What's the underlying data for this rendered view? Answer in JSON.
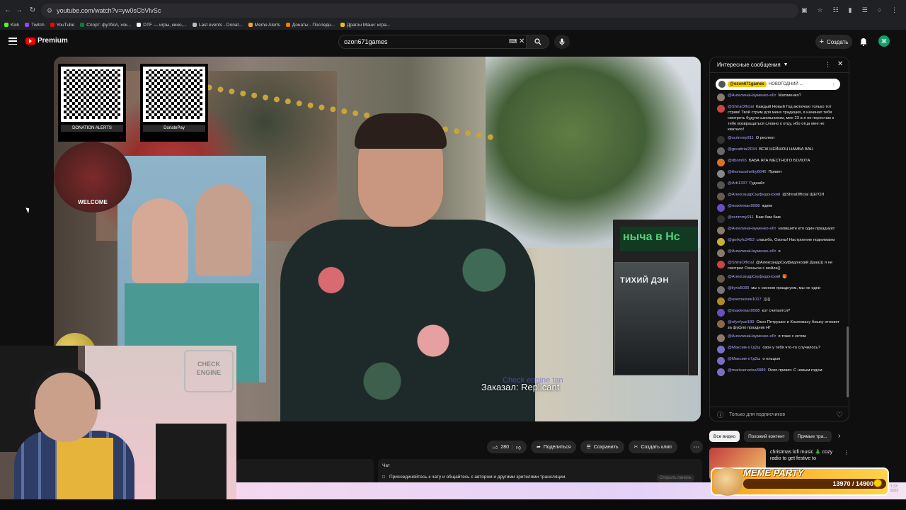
{
  "browser": {
    "url": "youtube.com/watch?v=yw0sCbVlvSc",
    "bookmarks": [
      {
        "label": "Kick",
        "color": "#53fc18"
      },
      {
        "label": "Twitch",
        "color": "#9146ff"
      },
      {
        "label": "YouTube",
        "color": "#ff0000"
      },
      {
        "label": "Спорт: футбол, хок...",
        "color": "#0a7d3a"
      },
      {
        "label": "DTF — игры, кино,...",
        "color": "#ffffff"
      },
      {
        "label": "Last events - Donat...",
        "color": "#bbbbbb"
      },
      {
        "label": "Meme Alerts",
        "color": "#f5a623"
      },
      {
        "label": "Донаты - Последн...",
        "color": "#f57c00"
      },
      {
        "label": "Драгон Мани: игра...",
        "color": "#f0c000"
      }
    ]
  },
  "yt": {
    "brand": "Premium",
    "search_value": "ozon671games",
    "create_label": "Создать",
    "avatar_letter": "Ж"
  },
  "video": {
    "caption": "Заказал: Replicant",
    "caption_ghost": "Check engine tan",
    "qr1_label": "DONATION ALERTS",
    "qr2_label": "DonatePay",
    "welcome": "WELCOME",
    "sign": "нычa в Нс",
    "book_title": "ТИХИЙ ДЭН",
    "facecam_sign": "CHECK ENGINE"
  },
  "chat": {
    "header": "Интересные сообщения",
    "pinned_user": "@ozon671games",
    "pinned_text": "НОВОГОДНИЙ ...",
    "messages": [
      {
        "user": "@АнгелинаНауменко-е6т",
        "text": "Матвиенко?",
        "color": "#8a7a6a"
      },
      {
        "user": "@ShiraOfficial",
        "text": "Каждый Новый Год включаю только тот стрим! Твой стрим для меня традиция, я начинал тебя смотреть будучи школьником, мне 23 а я не перестаю к тебе возвращаться словно к отцу, ибо отца мне не хватало!",
        "color": "#c44"
      },
      {
        "user": "@scrimmy911",
        "text": "О респект",
        "color": "#333"
      },
      {
        "user": "@greattrial2034",
        "text": "ВСЖ НЕЙШОН НАМБА ВАН",
        "color": "#6a6a6a"
      },
      {
        "user": "@rlbom65",
        "text": "БАБА ЯГА МЕСТНОГО БОЛОТА",
        "color": "#e07020"
      },
      {
        "user": "@thomasshelby6646",
        "text": "Привет",
        "color": "#888"
      },
      {
        "user": "@Arb1337",
        "text": "Гуднайс",
        "color": "#555"
      },
      {
        "user": "@АлександрСкуфидонский",
        "text": "@ShiraOfficial ЩЕГОЛ",
        "color": "#6b5b4b"
      },
      {
        "user": "@maxleman9588",
        "text": "ждем",
        "color": "#6a4fc4"
      },
      {
        "user": "@scrimmy911",
        "text": "Бам бам бам",
        "color": "#333"
      },
      {
        "user": "@АнгелинаНауменко-е6т",
        "text": "напишите кто один празднует",
        "color": "#8a7a6a"
      },
      {
        "user": "@gorkyfu3453",
        "text": "спасибо, Озоны! Настроение поднимаем",
        "color": "#c9b23a"
      },
      {
        "user": "@АнгелинаНауменко-е6т",
        "text": "я",
        "color": "#8a7a6a"
      },
      {
        "user": "@ShiraOfficial",
        "text": "@АлександрСкуфидонский Дааа))) я не смотрел Озоныча с мэйла))",
        "color": "#c44"
      },
      {
        "user": "@АлександрСкуфидонский",
        "text": "🎁",
        "color": "#6b5b4b"
      },
      {
        "user": "@ilyns5030",
        "text": "мы с озоном празднуем, мы не одни",
        "color": "#777"
      },
      {
        "user": "@usernamee1017",
        "text": ")))))",
        "color": "#b08a2a"
      },
      {
        "user": "@maxleman9588",
        "text": "кот считается?",
        "color": "#6a4fc4"
      },
      {
        "user": "@ofyefyue189",
        "text": "Озон Петрушке и Козломасу бошку отоовет за фуфло праздник НГ",
        "color": "#8a6a4a"
      },
      {
        "user": "@АнгелинаНауменко-е6т",
        "text": "я тоже с котом",
        "color": "#8a7a6a"
      },
      {
        "user": "@Максим-о7д2ш",
        "text": "озон у тебя что-то случилось?",
        "color": "#7a6fc4"
      },
      {
        "user": "@Максим-о7д2ш",
        "text": "о ельцын",
        "color": "#7a6fc4"
      },
      {
        "user": "@marisamarisa3889",
        "text": "Ozon привет. С новым годом",
        "color": "#7a6fc4"
      }
    ],
    "input_placeholder": "Только для подписчиков"
  },
  "actions": {
    "likes": "280",
    "share": "Поделиться",
    "save": "Сохранить",
    "clip": "Создать клип"
  },
  "chips": [
    "Все видео",
    "Похожий контент",
    "Прямые тра..."
  ],
  "recommended": {
    "title": "christmas lofi music 🎄 cozy radio to get festive to"
  },
  "chat_strip": {
    "title": "Чат",
    "info": "Присоединяйтесь к чату и общайтесь с автором и другими зрителями трансляции.",
    "button": "Открыть панель"
  },
  "meme_party": {
    "title": "MEME PARTY",
    "progress": "13970 / 14900",
    "progress_fraction": 0.9376
  },
  "clock": {
    "time": "1:33",
    "date": "2025"
  }
}
